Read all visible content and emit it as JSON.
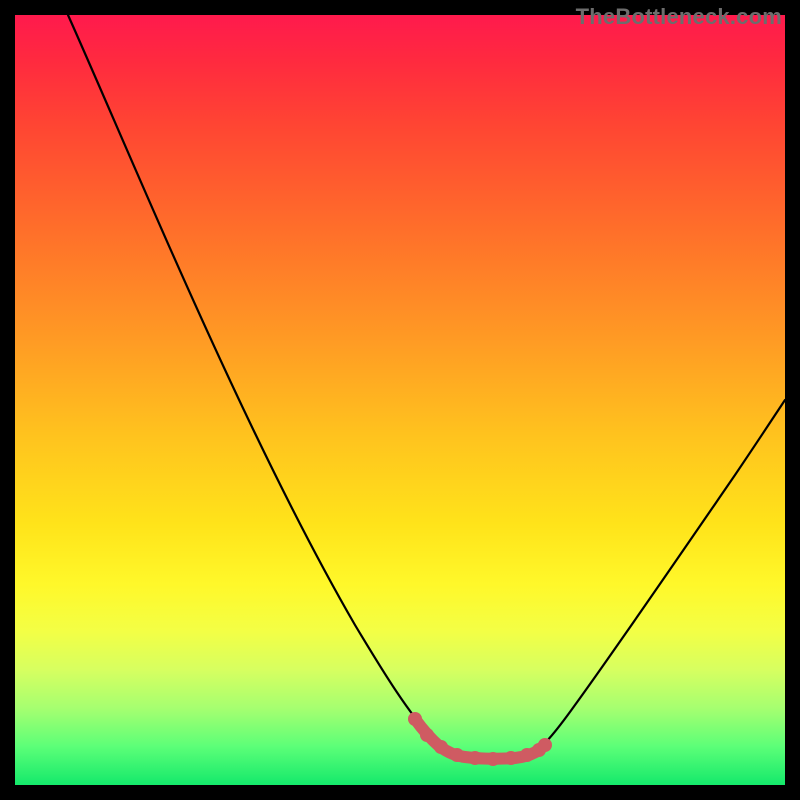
{
  "watermark": "TheBottleneck.com",
  "chart_data": {
    "type": "line",
    "title": "",
    "xlabel": "",
    "ylabel": "",
    "xlim": [
      0,
      100
    ],
    "ylim": [
      0,
      100
    ],
    "grid": false,
    "legend": false,
    "series": [
      {
        "name": "bottleneck-curve",
        "x": [
          0,
          5,
          10,
          15,
          20,
          25,
          30,
          35,
          40,
          45,
          50,
          52,
          54,
          56,
          58,
          60,
          62,
          64,
          66,
          68,
          72,
          76,
          80,
          84,
          88,
          92,
          96,
          100
        ],
        "y": [
          100,
          92,
          84,
          76,
          68,
          60,
          52,
          44,
          36,
          28,
          18,
          14,
          10,
          5,
          2,
          0,
          0,
          0,
          0,
          1,
          5,
          12,
          20,
          28,
          37,
          45,
          53,
          60
        ]
      }
    ],
    "highlight": {
      "note": "thick salmon segment at trough with dots",
      "x": [
        50,
        52,
        54,
        56,
        58,
        60,
        62,
        64,
        66,
        68
      ],
      "y": [
        18,
        14,
        10,
        5,
        2,
        0,
        0,
        0,
        0,
        1
      ]
    },
    "colors": {
      "background_gradient_top": "#ff1a4d",
      "background_gradient_bottom": "#14e96b",
      "curve": "#000000",
      "highlight": "#cf5b62"
    }
  }
}
